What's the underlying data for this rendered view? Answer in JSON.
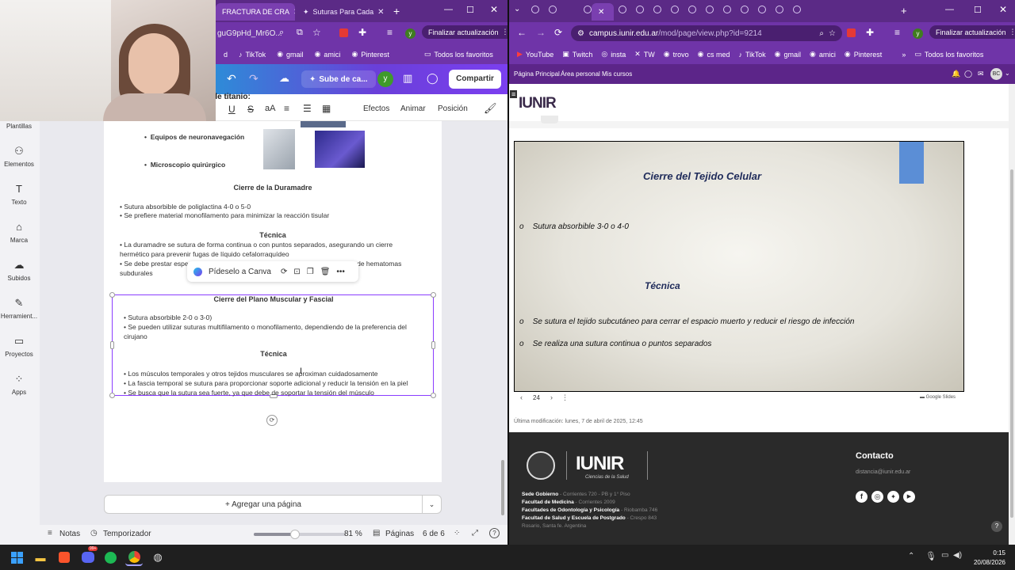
{
  "left_browser": {
    "tabs": [
      {
        "label": "FRACTURA DE CRA"
      },
      {
        "label": "Suturas Para Cada"
      }
    ],
    "url_fragment": "guG9pHd_Mr6O...",
    "profile_letter": "y",
    "update_label": "Finalizar actualización",
    "bookmarks": [
      "d",
      "TikTok",
      "gmail",
      "amici",
      "Pinterest"
    ],
    "all_bookmarks": "Todos los favoritos"
  },
  "canva": {
    "title_button": "Sube de ca...",
    "user_initial": "y",
    "share": "Compartir",
    "format_bar": {
      "effects": "Efectos",
      "animate": "Animar",
      "position": "Posición",
      "size": "aA"
    },
    "partial_heading": "de titanio:",
    "sidebar": [
      {
        "label": "Plantillas"
      },
      {
        "label": "Elementos"
      },
      {
        "label": "Texto"
      },
      {
        "label": "Marca"
      },
      {
        "label": "Subidos"
      },
      {
        "label": "Herramient..."
      },
      {
        "label": "Proyectos"
      },
      {
        "label": "Apps"
      }
    ],
    "doc": {
      "item1": "Equipos de neuronavegación",
      "item2": "Microscopio quirúrgico",
      "h_dura": "Cierre de la Duramadre",
      "dura_bullets": [
        "Sutura absorbible de poliglactina 4-0 o 5-0",
        "Se prefiere material monofilamento para minimizar la reacción tisular"
      ],
      "h_tec1": "Técnica",
      "tec1_line1": "La duramadre se sutura de forma continua o con puntos separados, asegurando un cierre",
      "tec1_line2": "hermético para prevenir fugas de líquido cefalorraquídeo",
      "tec1_line3a": "Se debe prestar especi",
      "tec1_line3b": "n de hematomas",
      "tec1_line4": "subdurales",
      "pideselo": "Pídeselo a Canva",
      "h_muscle": "Cierre del Plano Muscular y Fascial",
      "muscle_b1": "Sutura absorbible 2-0 o 3-0)",
      "muscle_b2a": "Se pueden utilizar suturas multifilamento o monofilamento, dependiendo de la preferencia del",
      "muscle_b2b": "cirujano",
      "h_tec2": "Técnica",
      "tec2": [
        "Los músculos temporales y otros tejidos musculares se aproximan cuidadosamente",
        "La fascia temporal se sutura para proporcionar soporte adicional y reducir la tensión en la piel",
        "Se busca que la sutura sea fuerte, ya que debe de soportar la tensión del músculo"
      ]
    },
    "add_page": "+ Agregar una página",
    "bottom": {
      "notes": "Notas",
      "timer": "Temporizador",
      "zoom": "81 %",
      "pages_label": "Páginas",
      "pages": "6 de 6",
      "zoom_fraction": 0.45
    }
  },
  "right_browser": {
    "url": "campus.iunir.edu.ar/mod/page/view.php?id=9214",
    "url_host": "campus.iunir.edu.ar",
    "url_path": "/mod/page/view.php?id=9214",
    "profile_letter": "y",
    "update_label": "Finalizar actualización",
    "bookmarks": [
      "YouTube",
      "Twitch",
      "insta",
      "TW",
      "trovo",
      "cs med",
      "TikTok",
      "gmail",
      "amici",
      "Pinterest"
    ],
    "all_bookmarks": "Todos los favoritos",
    "nav": [
      "Página Principal",
      "Área personal",
      "Mis cursos"
    ],
    "avatar": "BC",
    "logo": "IUNIR",
    "logo_sub": "Ciencias de la Salud",
    "slide": {
      "title": "Cierre del  Tejido Celular",
      "b1": "Sutura absorbible 3-0 o 4-0",
      "h2": "Técnica",
      "b2": "Se sutura el tejido subcutáneo para cerrar el espacio muerto y reducir el riesgo de infección",
      "b3": "Se realiza una sutura continua o puntos separados"
    },
    "slide_page": "24",
    "google_slides": "Google Slides",
    "modified": "Última modificación: lunes, 7 de abril de 2025, 12:45",
    "footer": {
      "contact_title": "Contacto",
      "contact_email": "distancia@iunir.edu.ar",
      "addr": [
        {
          "name": "Sede Gobierno",
          "val": " - Corrientes 720 - PB y 1° Piso"
        },
        {
          "name": "Facultad de Medicina",
          "val": " - Corrientes 2009"
        },
        {
          "name": "Facultades de Odontología y Psicología",
          "val": " - Riobamba 746"
        },
        {
          "name": "Facultad de Salud y Escuela de Postgrado",
          "val": " - Crespo 843"
        }
      ],
      "city": "Rosario, Santa fe. Argentina"
    }
  },
  "taskbar": {
    "time": "0:15",
    "date": "20/08/2026",
    "badge": "99+"
  },
  "colors": {
    "purple": "#6f34a8",
    "dark_purple": "#5b2a86",
    "canva_purple": "#8b3dff",
    "footer_bg": "#2a2a2a"
  }
}
